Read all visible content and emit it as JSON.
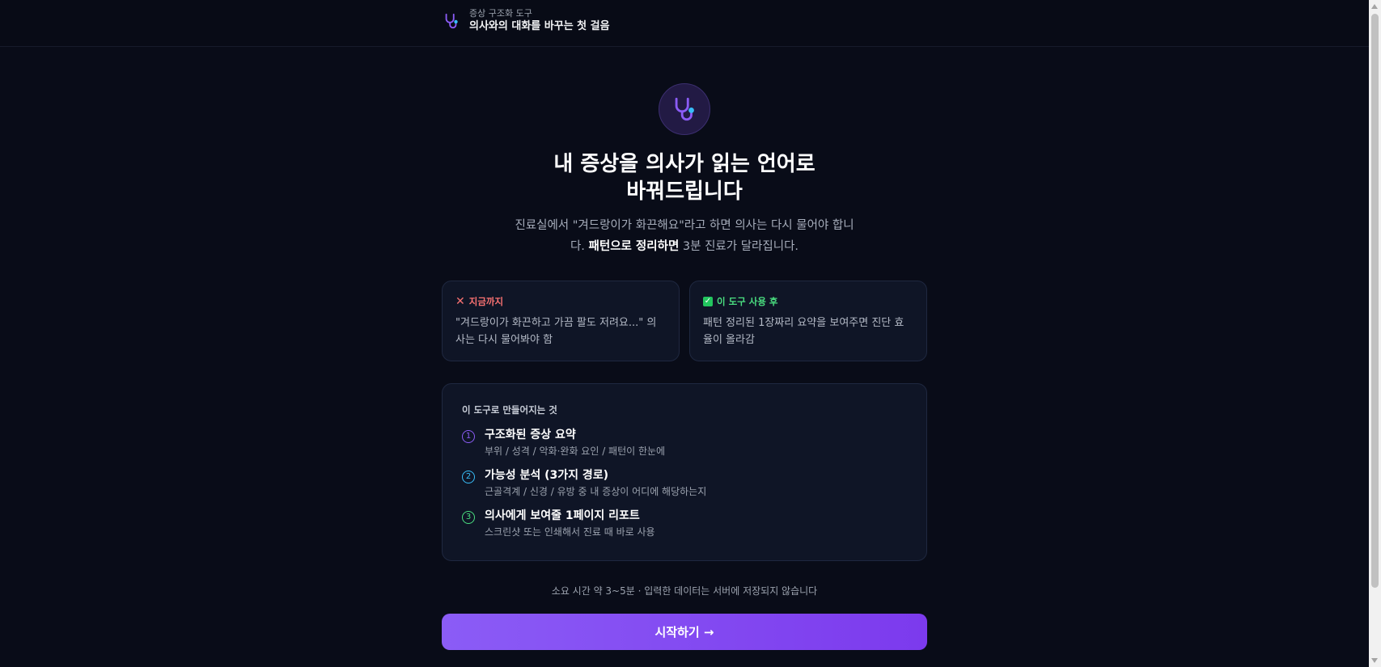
{
  "header": {
    "subtitle": "증상 구조화 도구",
    "title": "의사와의 대화를 바꾸는 첫 걸음",
    "icon": "stethoscope-icon"
  },
  "hero": {
    "icon": "stethoscope-icon",
    "headline_line1": "내 증상을 의사가 읽는 언어로",
    "headline_line2": "바꿔드립니다",
    "lead_part1": "진료실에서 \"겨드랑이가 화끈해요\"라고 하면 의사는 다시 물어야 합니다. ",
    "lead_bold": "패턴으로 정리하면",
    "lead_part2": " 3분 진료가 달라집니다."
  },
  "compare": {
    "before": {
      "label": "지금까지",
      "icon": "x-icon",
      "text": "\"겨드랑이가 화끈하고 가끔 팔도 저려요...\" 의사는 다시 물어봐야 함"
    },
    "after": {
      "label": "이 도구 사용 후",
      "icon": "check-box-icon",
      "text": "패턴 정리된 1장짜리 요약을 보여주면 진단 효율이 올라감"
    }
  },
  "outputs": {
    "title": "이 도구로 만들어지는 것",
    "items": [
      {
        "num": "1",
        "title": "구조화된 증상 요약",
        "desc": "부위 / 성격 / 악화·완화 요인 / 패턴이 한눈에",
        "color": "#8b5cf6"
      },
      {
        "num": "2",
        "title": "가능성 분석 (3가지 경로)",
        "desc": "근골격계 / 신경 / 유방 중 내 증상이 어디에 해당하는지",
        "color": "#38bdf8"
      },
      {
        "num": "3",
        "title": "의사에게 보여줄 1페이지 리포트",
        "desc": "스크린샷 또는 인쇄해서 진료 때 바로 사용",
        "color": "#4ade80"
      }
    ]
  },
  "footnote": "소요 시간 약 3~5분 · 입력한 데이터는 서버에 저장되지 않습니다",
  "start_button": {
    "label": "시작하기 →",
    "color": "#8b5cf6"
  }
}
